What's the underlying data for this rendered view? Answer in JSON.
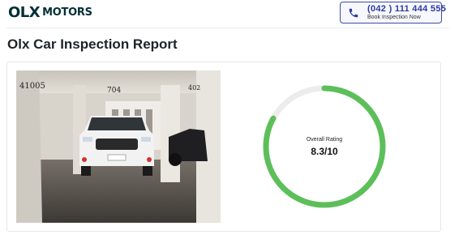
{
  "header": {
    "logo_mark": "OLX",
    "logo_text": "MOTORS",
    "cta": {
      "phone": "(042 ) 111 444 555",
      "label": "Book Inspection Now",
      "icon": "phone-icon"
    }
  },
  "page": {
    "title": "Olx Car Inspection Report"
  },
  "report": {
    "photo_labels": [
      "41005",
      "704",
      "402"
    ],
    "rating_label": "Overall Rating",
    "rating_value": "8.3/10",
    "rating_fraction": 0.83
  },
  "colors": {
    "brand": "#002f34",
    "accent": "#3a4aa6",
    "rating_ring": "#5cbf59",
    "rating_track": "#ececec"
  }
}
